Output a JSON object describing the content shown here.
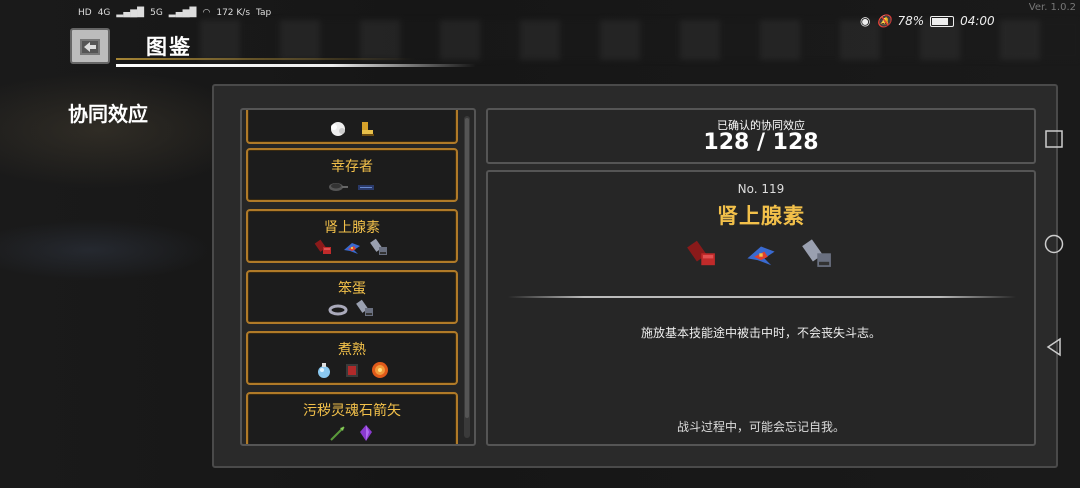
{
  "status_bar": {
    "left_items": [
      "HD",
      "4G",
      "5G",
      "172 K/s",
      "Tap"
    ],
    "battery": "78%",
    "time": "04:00"
  },
  "version": "Ver. 1.0.2",
  "header": {
    "title": "图鉴"
  },
  "section_title": "协同效应",
  "synergy_list": [
    {
      "name": "",
      "icons": [
        "white-fluff-icon",
        "golden-boot-icon"
      ]
    },
    {
      "name": "幸存者",
      "icons": [
        "frying-pan-icon",
        "label-tag-icon"
      ]
    },
    {
      "name": "肾上腺素",
      "icons": [
        "red-gauntlet-icon",
        "wing-emblem-icon",
        "metal-gauntlet-icon"
      ]
    },
    {
      "name": "笨蛋",
      "icons": [
        "metal-ring-icon",
        "metal-gauntlet-icon"
      ]
    },
    {
      "name": "煮熟",
      "icons": [
        "blue-potion-icon",
        "red-box-icon",
        "fireball-icon"
      ]
    },
    {
      "name": "污秽灵魂石箭矢",
      "icons": [
        "green-arrow-icon",
        "purple-crystal-icon"
      ]
    }
  ],
  "count": {
    "label": "已确认的协同效应",
    "value": "128 / 128"
  },
  "detail": {
    "number": "No. 119",
    "name": "肾上腺素",
    "icons": [
      "red-gauntlet-icon",
      "wing-emblem-icon",
      "metal-gauntlet-icon"
    ],
    "description": "施放基本技能途中被击中时，不会丧失斗志。",
    "flavor": "战斗过程中，可能会忘记自我。"
  },
  "colors": {
    "accent_gold": "#f2c04a",
    "card_border": "#b07a28",
    "panel_bg": "#2a2a2a"
  }
}
